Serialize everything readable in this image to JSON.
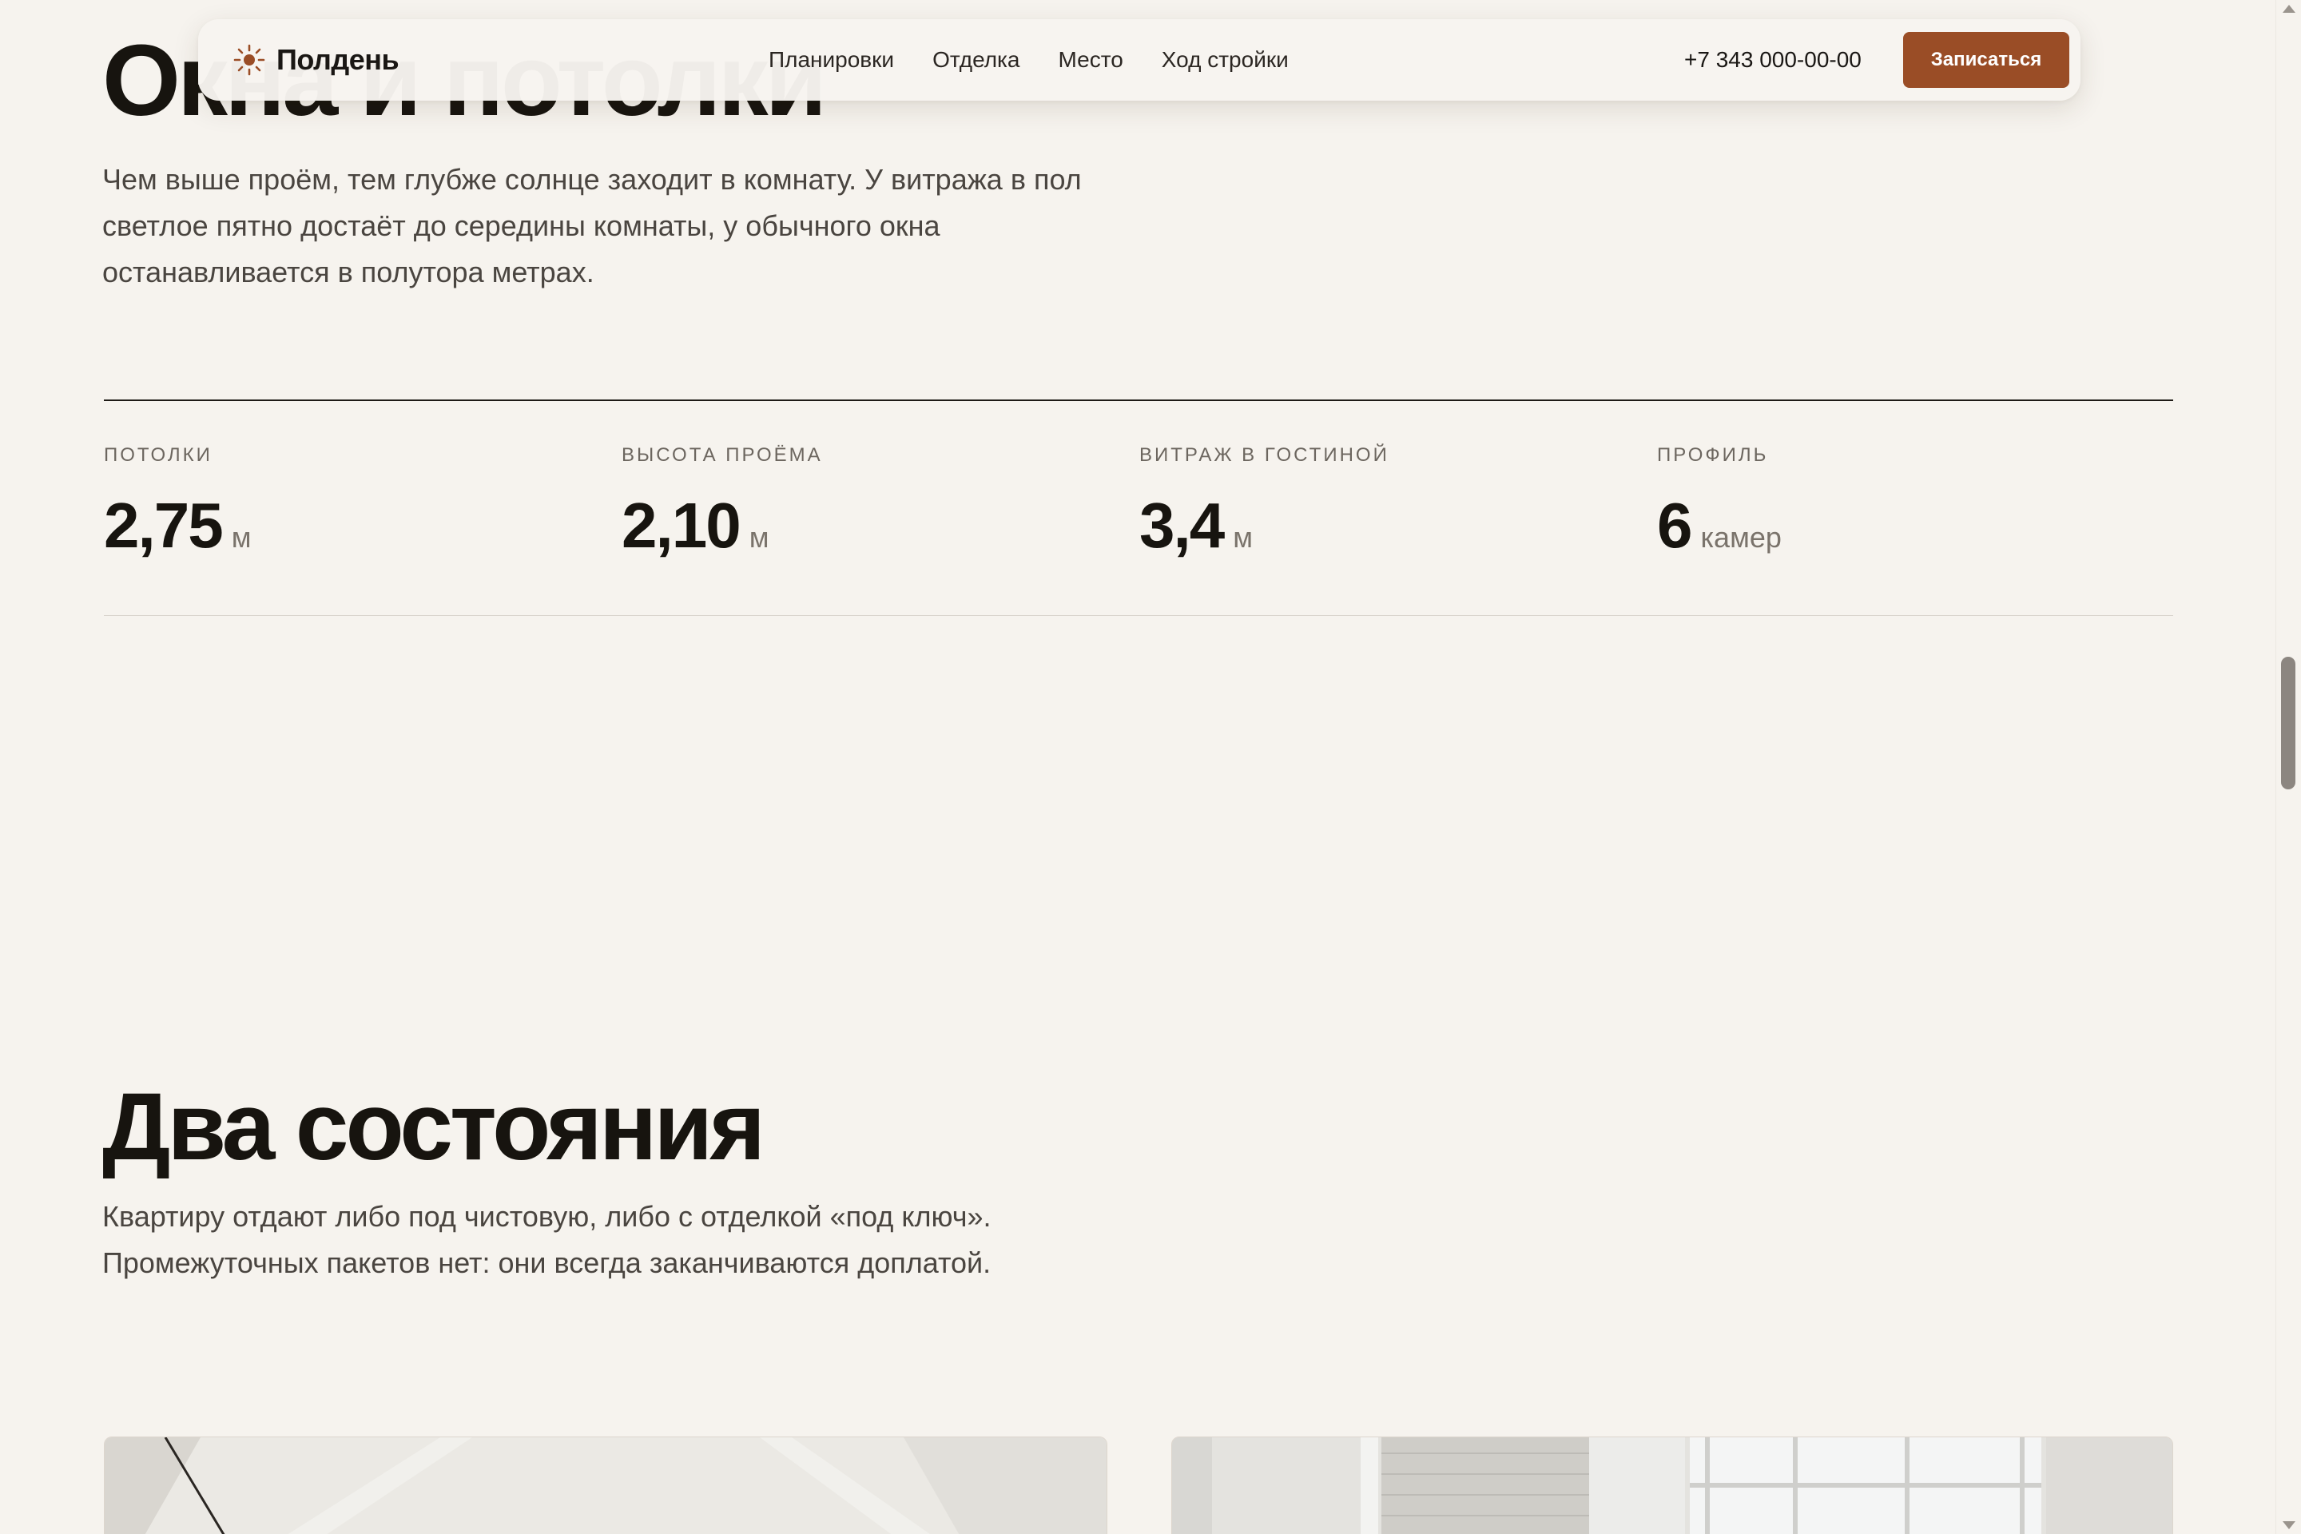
{
  "nav": {
    "brand": "Полдень",
    "brand_icon": "sun-icon",
    "links": [
      "Планировки",
      "Отделка",
      "Место",
      "Ход стройки"
    ],
    "phone": "+7 343 000-00-00",
    "cta": "Записаться"
  },
  "section_windows": {
    "title": "Окна и потолки",
    "text": "Чем выше проём, тем глубже солнце заходит в комнату. У витража в пол светлое пятно достаёт до середины комнаты, у обычного окна останавливается в полутора метрах.",
    "stats": [
      {
        "label": "ПОТОЛКИ",
        "value": "2,75",
        "unit": "м"
      },
      {
        "label": "ВЫСОТА ПРОЁМА",
        "value": "2,10",
        "unit": "м"
      },
      {
        "label": "ВИТРАЖ В ГОСТИНОЙ",
        "value": "3,4",
        "unit": "м"
      },
      {
        "label": "ПРОФИЛЬ",
        "value": "6",
        "unit": "камер"
      }
    ]
  },
  "section_states": {
    "title": "Два состояния",
    "text": "Квартиру отдают либо под чистовую, либо с отделкой «под ключ». Промежуточных пакетов нет: они всегда заканчиваются доплатой."
  },
  "colors": {
    "background": "#f6f3ee",
    "accent": "#9a4d26",
    "text": "#17140f",
    "muted": "#4a4540"
  }
}
